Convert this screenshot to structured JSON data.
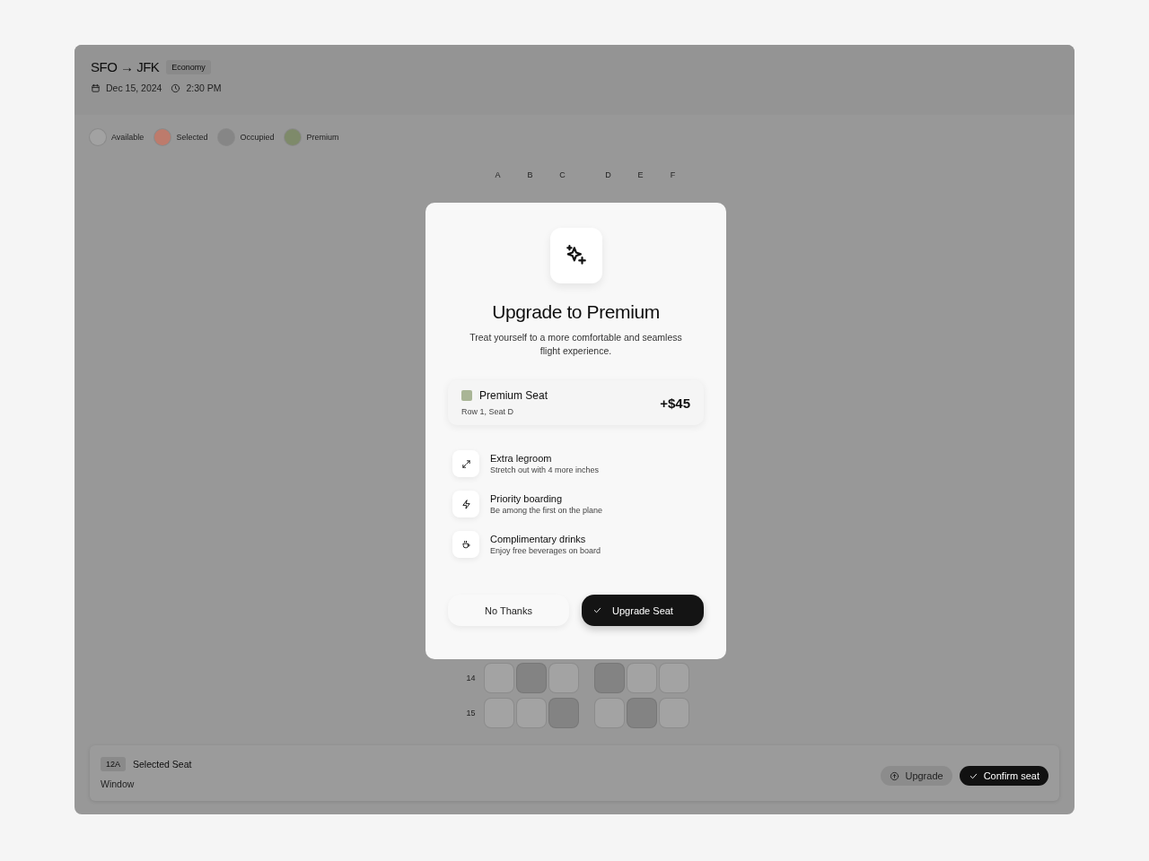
{
  "header": {
    "route": "SFO → JFK",
    "cabin_badge": "Economy",
    "date": "Dec 15, 2024",
    "time": "2:30 PM"
  },
  "legend": [
    {
      "label": "Available",
      "color": "#a2a2a2"
    },
    {
      "label": "Selected",
      "color": "#bd7b6c"
    },
    {
      "label": "Occupied",
      "color": "#868686"
    },
    {
      "label": "Premium",
      "color": "#7e8a6a"
    }
  ],
  "seat_columns": [
    "A",
    "B",
    "C",
    "D",
    "E",
    "F"
  ],
  "seat_rows": [
    {
      "label": "14",
      "seats": [
        {
          "occupied": false
        },
        {
          "occupied": true
        },
        {
          "occupied": false
        },
        {
          "occupied": true
        },
        {
          "occupied": false
        },
        {
          "occupied": false
        }
      ]
    },
    {
      "label": "15",
      "seats": [
        {
          "occupied": false
        },
        {
          "occupied": false
        },
        {
          "occupied": true
        },
        {
          "occupied": false
        },
        {
          "occupied": true
        },
        {
          "occupied": false
        }
      ]
    }
  ],
  "selection_bar": {
    "seat_badge": "12A",
    "title": "Selected Seat",
    "seat_type": "Window",
    "buttons": [
      {
        "label": "Upgrade",
        "kind": "secondary"
      },
      {
        "label": "Confirm seat",
        "kind": "primary"
      }
    ]
  },
  "modal": {
    "title": "Upgrade to Premium",
    "description": "Treat yourself to a more comfortable and seamless flight experience.",
    "offer": {
      "name": "Premium Seat",
      "color": "#a9b596",
      "location": "Row 1, Seat D",
      "price": "+$45"
    },
    "benefits": [
      {
        "kind": "legroom",
        "title": "Extra legroom",
        "detail": "Stretch out with 4 more inches"
      },
      {
        "kind": "boarding",
        "title": "Priority boarding",
        "detail": "Be among the first on the plane"
      },
      {
        "kind": "drinks",
        "title": "Complimentary drinks",
        "detail": "Enjoy free beverages on board"
      }
    ],
    "buttons": [
      {
        "label": "No Thanks",
        "kind": "secondary"
      },
      {
        "label": "Upgrade Seat",
        "kind": "primary"
      }
    ]
  }
}
